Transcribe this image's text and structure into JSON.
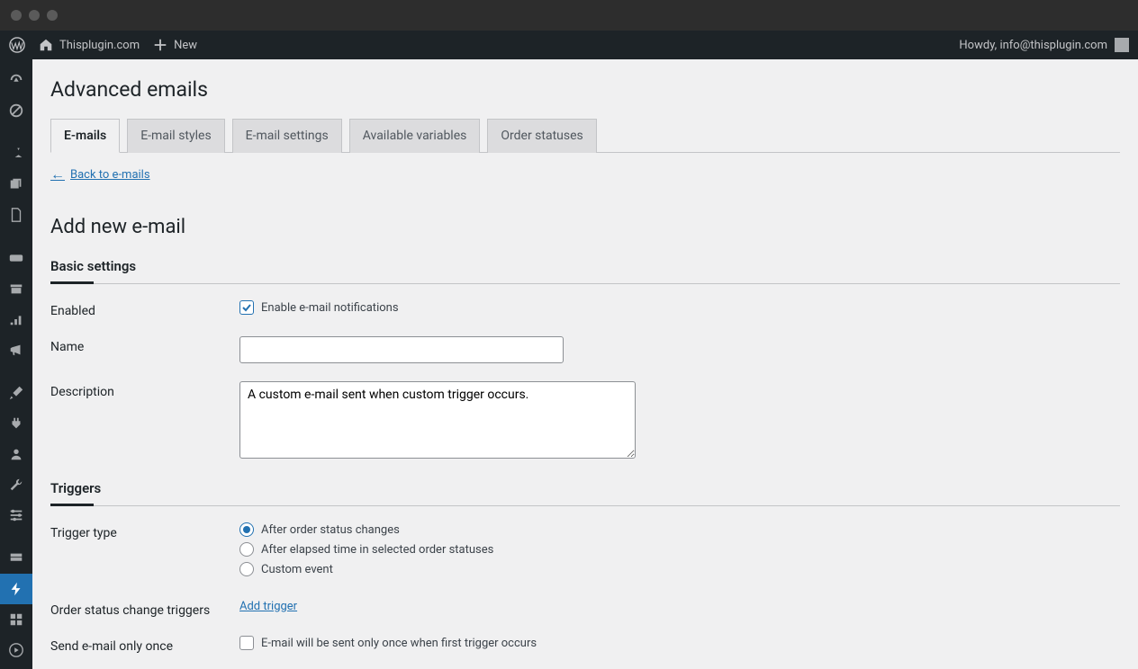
{
  "adminbar": {
    "site_name": "Thisplugin.com",
    "new_label": "New",
    "howdy": "Howdy, info@thisplugin.com"
  },
  "page": {
    "title": "Advanced emails",
    "back_link": "Back to e-mails",
    "section_title": "Add new e-mail"
  },
  "tabs": [
    {
      "label": "E-mails",
      "active": true
    },
    {
      "label": "E-mail styles",
      "active": false
    },
    {
      "label": "E-mail settings",
      "active": false
    },
    {
      "label": "Available variables",
      "active": false
    },
    {
      "label": "Order statuses",
      "active": false
    }
  ],
  "basic": {
    "heading": "Basic settings",
    "enabled_label": "Enabled",
    "enabled_checkbox_label": "Enable e-mail notifications",
    "enabled_checked": true,
    "name_label": "Name",
    "name_value": "",
    "description_label": "Description",
    "description_value": "A custom e-mail sent when custom trigger occurs."
  },
  "triggers": {
    "heading": "Triggers",
    "type_label": "Trigger type",
    "options": [
      {
        "label": "After order status changes",
        "checked": true
      },
      {
        "label": "After elapsed time in selected order statuses",
        "checked": false
      },
      {
        "label": "Custom event",
        "checked": false
      }
    ],
    "status_change_label": "Order status change triggers",
    "add_trigger_link": "Add trigger",
    "send_once_label": "Send e-mail only once",
    "send_once_checkbox_label": "E-mail will be sent only once when first trigger occurs",
    "send_once_checked": false
  }
}
